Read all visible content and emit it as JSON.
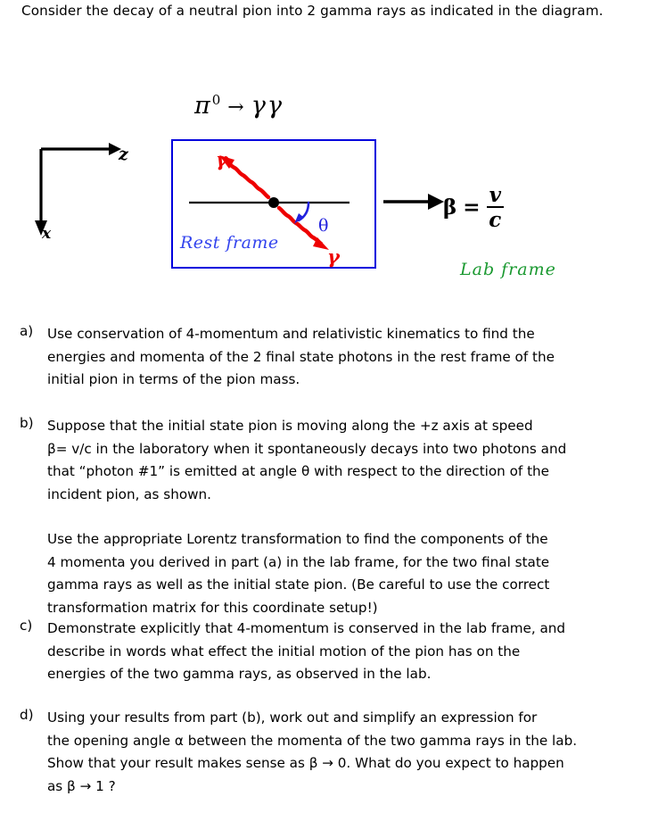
{
  "intro": {
    "text": "Consider the decay of a neutral pion into 2 gamma rays as indicated in the diagram."
  },
  "figure": {
    "reaction": {
      "particle": "π",
      "superscript": "0",
      "arrow": "→",
      "products": "γγ"
    },
    "axes": {
      "z_label": "z",
      "x_label": "x"
    },
    "rest_frame_box": {
      "caption": "Rest frame",
      "theta_label": "θ",
      "gamma_upper_label": "γ",
      "gamma_lower_label": "γ",
      "border_color": "#0000dd",
      "gamma_color": "#ee0000",
      "caption_color": "#3344ee"
    },
    "boost": {
      "beta_symbol": "β",
      "equals": "=",
      "numerator": "v",
      "denominator": "c"
    },
    "lab_frame_caption": "Lab frame",
    "lab_frame_color": "#1a9930"
  },
  "questions": [
    {
      "marker": "a)",
      "lines": [
        "Use conservation of 4-momentum and relativistic kinematics to find the",
        "energies and momenta of the 2 final state photons in the rest frame of the",
        "initial pion in terms of the pion mass."
      ]
    },
    {
      "marker": "b)",
      "lines": [
        "Suppose that the initial state pion is moving along the +z axis at speed",
        "β= v/c in the laboratory when it spontaneously decays into two photons and",
        "that “photon #1” is emitted at angle θ with respect to the direction of the",
        "incident pion, as shown.",
        "",
        "Use the appropriate Lorentz transformation to find the components of the",
        "4 momenta you derived in part (a) in the lab frame,  for the two final state",
        "gamma rays as well as the initial state pion. (Be careful to use the correct",
        "transformation matrix for this coordinate setup!)"
      ]
    },
    {
      "marker": "c)",
      "lines": [
        "Demonstrate explicitly that 4-momentum is conserved in the lab frame, and",
        "describe in words what effect the initial motion of the pion has on the",
        "energies of the two gamma rays, as observed in the lab."
      ]
    },
    {
      "marker": "d)",
      "lines": [
        "Using your results from part (b), work out and simplify an expression for",
        "the opening angle α between the momenta of the two gamma rays in the lab.",
        "Show that your result makes sense as  β → 0. What do you expect to happen",
        "as  β → 1 ?"
      ]
    }
  ]
}
